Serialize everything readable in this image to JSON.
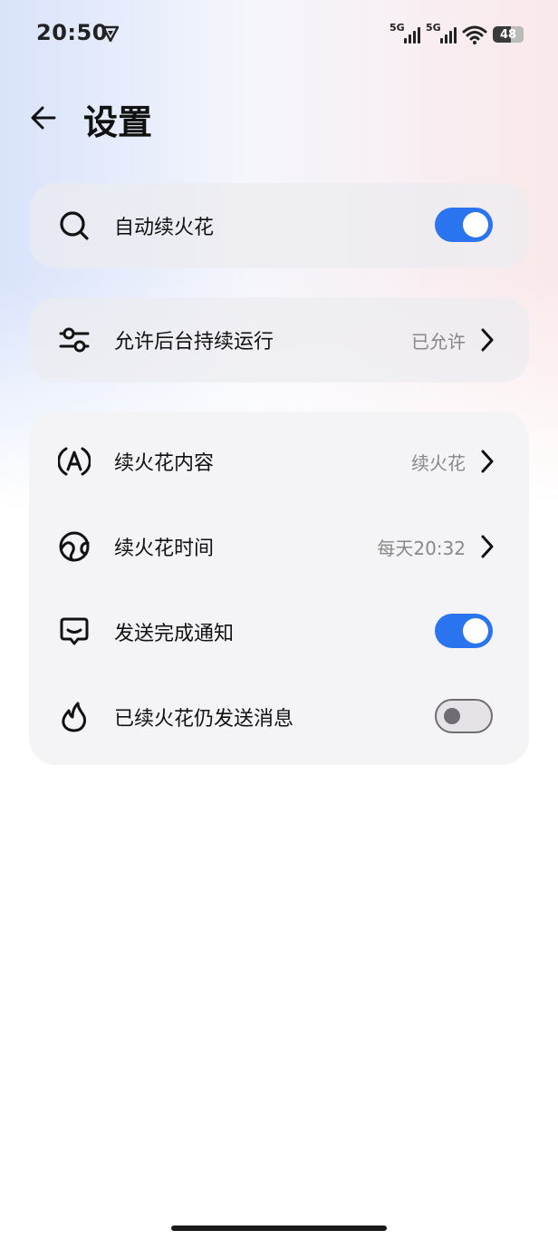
{
  "status_bar": {
    "time": "20:50",
    "network1": "5G",
    "network2": "5G",
    "battery": "48"
  },
  "header": {
    "title": "设置"
  },
  "settings": {
    "auto_fire": {
      "label": "自动续火花",
      "enabled": true
    },
    "background_run": {
      "label": "允许后台持续运行",
      "value": "已允许"
    },
    "fire_content": {
      "label": "续火花内容",
      "value": "续火花"
    },
    "fire_time": {
      "label": "续火花时间",
      "value": "每天20:32"
    },
    "notify_done": {
      "label": "发送完成通知",
      "enabled": true
    },
    "send_when_done": {
      "label": "已续火花仍发送消息",
      "enabled": false
    }
  },
  "colors": {
    "toggle_on": "#2b74f0",
    "toggle_off": "#e6e3e8"
  },
  "icons": [
    "back-arrow-icon",
    "search-icon",
    "sliders-icon",
    "a-circle-icon",
    "globe-icon",
    "message-icon",
    "flame-icon",
    "chevron-right-icon"
  ]
}
